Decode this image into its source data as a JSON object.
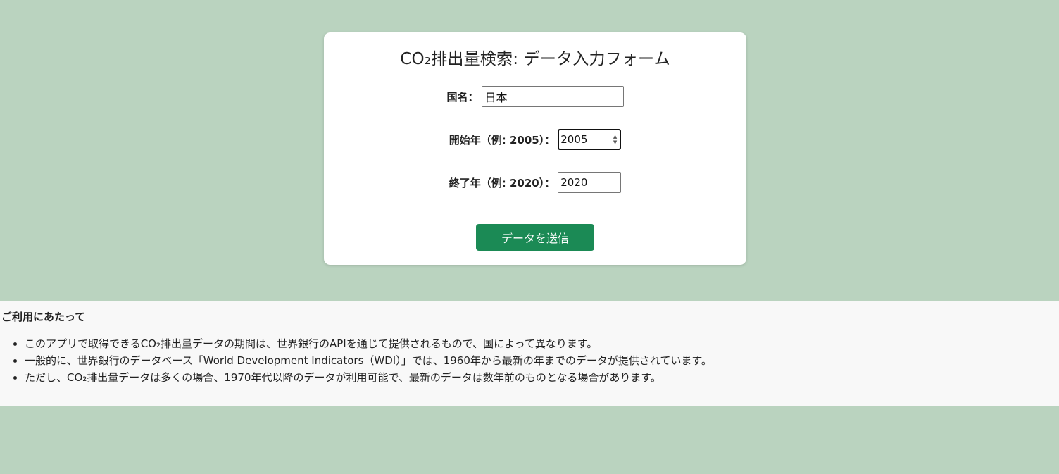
{
  "form": {
    "title": "CO₂排出量検索: データ入力フォーム",
    "country": {
      "label": "国名：",
      "value": "日本"
    },
    "start_year": {
      "label": "開始年（例: 2005）：",
      "value": "2005"
    },
    "end_year": {
      "label": "終了年（例: 2020）：",
      "value": "2020"
    },
    "submit_label": "データを送信"
  },
  "notice": {
    "title": "ご利用にあたって",
    "items": [
      "このアプリで取得できるCO₂排出量データの期間は、世界銀行のAPIを通じて提供されるもので、国によって異なります。",
      "一般的に、世界銀行のデータベース「World Development Indicators（WDI）」では、1960年から最新の年までのデータが提供されています。",
      "ただし、CO₂排出量データは多くの場合、1970年代以降のデータが利用可能で、最新のデータは数年前のものとなる場合があります。"
    ]
  },
  "icons": {
    "spinner_up": "▲",
    "spinner_down": "▼"
  }
}
